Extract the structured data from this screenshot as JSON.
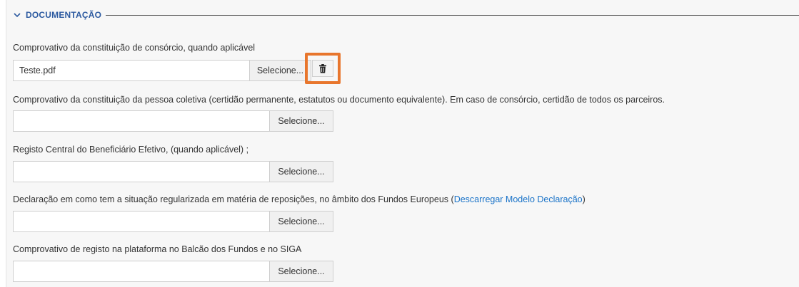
{
  "section": {
    "title": "DOCUMENTAÇÃO",
    "icon": "chevron-down-icon"
  },
  "fields": [
    {
      "label": "Comprovativo da constituição de consórcio, quando aplicável",
      "value": "Teste.pdf",
      "button": "Selecione...",
      "delete_icon": "trash-icon"
    },
    {
      "label": "Comprovativo da constituição da pessoa coletiva (certidão permanente, estatutos ou documento equivalente). Em caso de consórcio, certidão de todos os parceiros.",
      "value": "",
      "button": "Selecione..."
    },
    {
      "label": "Registo Central do Beneficiário Efetivo, (quando aplicável) ;",
      "value": "",
      "button": "Selecione..."
    },
    {
      "label": "Declaração em como tem a situação regularizada em matéria de reposições, no âmbito dos Fundos Europeus (",
      "link": "Descarregar Modelo Declaração",
      "label_suffix": ")",
      "value": "",
      "button": "Selecione..."
    },
    {
      "label": "Comprovativo de registo na plataforma no Balcão dos Fundos e no SIGA",
      "value": "",
      "button": "Selecione..."
    }
  ],
  "colors": {
    "accent": "#e8762d",
    "title": "#2c5aa0",
    "link": "#1a73c8"
  }
}
